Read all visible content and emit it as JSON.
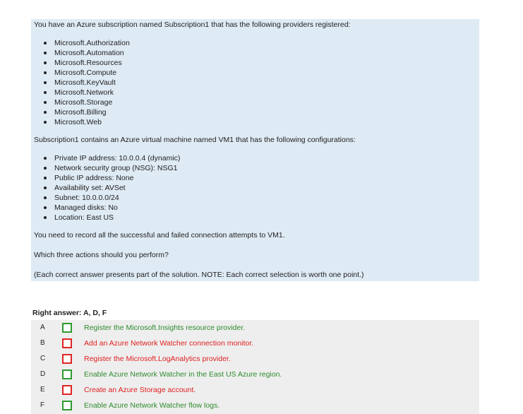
{
  "question": {
    "intro": "You have an Azure subscription named Subscription1 that has the following providers registered:",
    "providers": [
      "Microsoft.Authorization",
      "Microsoft.Automation",
      "Microsoft.Resources",
      "Microsoft.Compute",
      "Microsoft.KeyVault",
      "Microsoft.Network",
      "Microsoft.Storage",
      "Microsoft.Billing",
      "Microsoft.Web"
    ],
    "vm_intro": "Subscription1 contains an Azure virtual machine named VM1 that has the following configurations:",
    "vm_config": [
      "Private IP address: 10.0.0.4 (dynamic)",
      "Network security group (NSG): NSG1",
      "Public IP address: None",
      "Availability set: AVSet",
      "Subnet: 10.0.0.0/24",
      "Managed disks: No",
      "Location: East US"
    ],
    "requirement": "You need to record all the successful and failed connection attempts to VM1.",
    "prompt": "Which three actions should you perform?",
    "note": "(Each correct answer presents part of the solution. NOTE: Each correct selection is worth one point.)"
  },
  "right_answer_label": "Right answer: A, D, F",
  "colors": {
    "question_background": "#deeaf4",
    "answers_background": "#eeeeee",
    "correct": "#2e8b2e",
    "wrong": "#e02020"
  },
  "answers": [
    {
      "letter": "A",
      "text": "Register the Microsoft.Insights resource provider.",
      "correct": true
    },
    {
      "letter": "B",
      "text": "Add an Azure Network Watcher connection monitor.",
      "correct": false
    },
    {
      "letter": "C",
      "text": "Register the Microsoft.LogAnalytics provider.",
      "correct": false
    },
    {
      "letter": "D",
      "text": "Enable Azure Network Watcher in the East US Azure region.",
      "correct": true
    },
    {
      "letter": "E",
      "text": "Create an Azure Storage account.",
      "correct": false
    },
    {
      "letter": "F",
      "text": "Enable Azure Network Watcher flow logs.",
      "correct": true
    }
  ]
}
